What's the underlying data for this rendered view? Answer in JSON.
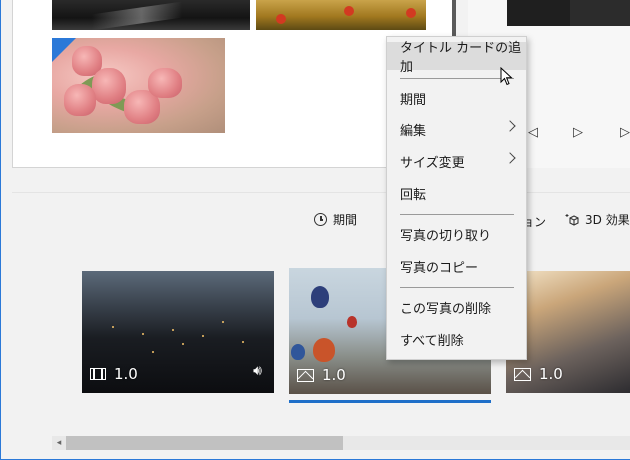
{
  "context_menu": {
    "items": [
      {
        "label": "タイトル カードの追加",
        "has_submenu": false,
        "hover": true
      },
      {
        "label": "期間",
        "has_submenu": false
      },
      {
        "label": "編集",
        "has_submenu": true
      },
      {
        "label": "サイズ変更",
        "has_submenu": true
      },
      {
        "label": "回転",
        "has_submenu": false
      },
      {
        "label": "写真の切り取り",
        "has_submenu": false
      },
      {
        "label": "写真のコピー",
        "has_submenu": false
      },
      {
        "label": "この写真の削除",
        "has_submenu": false
      },
      {
        "label": "すべて削除",
        "has_submenu": false
      }
    ]
  },
  "storyboard_toolbar": {
    "duration_label": "期間",
    "motion_label_fragment": "ョン",
    "effects_3d_label": "3D 効果"
  },
  "storyboard_clips": [
    {
      "kind": "video",
      "icon": "film-icon",
      "duration": "1.0",
      "has_audio": true
    },
    {
      "kind": "photo",
      "icon": "picture-icon",
      "duration": "1.0",
      "selected": true
    },
    {
      "kind": "photo",
      "icon": "picture-icon",
      "duration": "1.0"
    }
  ],
  "preview_controls": {
    "prev": "◁",
    "play": "▷",
    "next": "▷"
  },
  "colors": {
    "accent": "#2b79d8",
    "selection_bar": "#1f6fc9",
    "menu_background": "#f2f2f2",
    "menu_hover": "#dcdcdc"
  }
}
